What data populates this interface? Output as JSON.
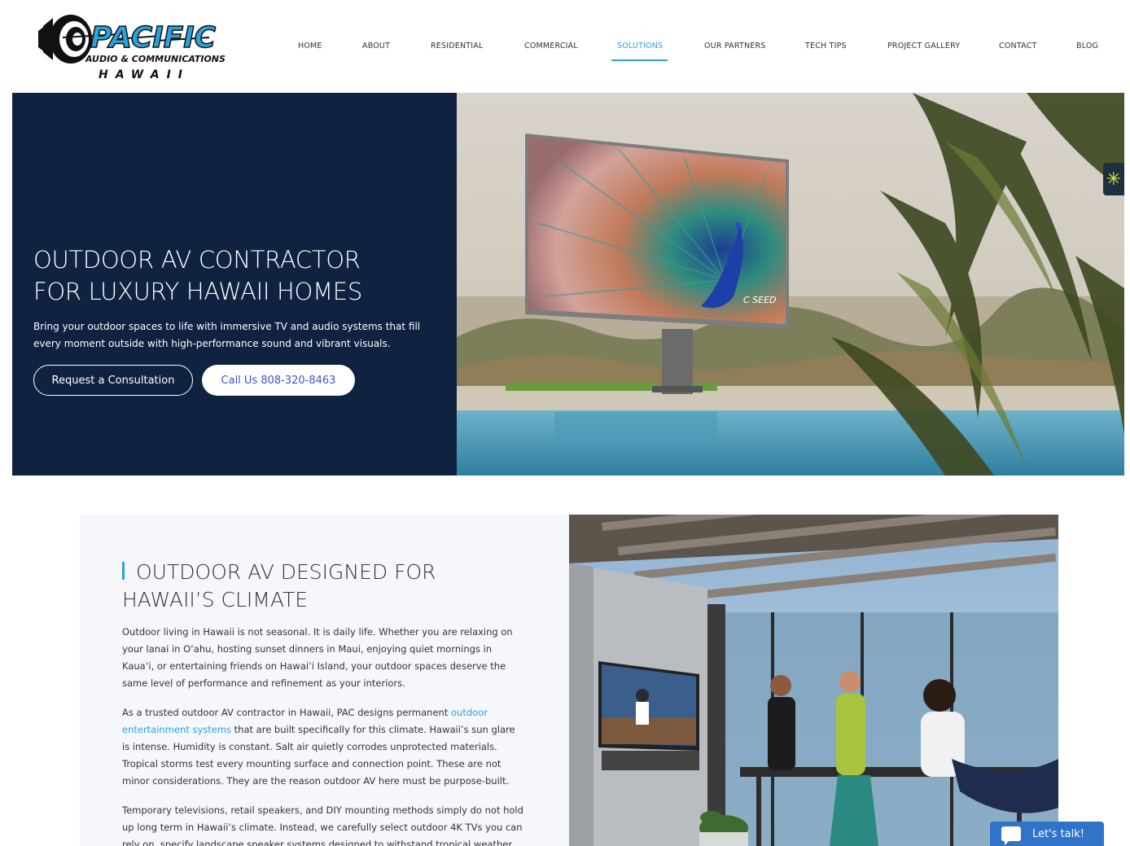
{
  "brand": {
    "logo_word": "PACIFIC",
    "logo_sub": "AUDIO & COMMUNICATIONS",
    "logo_region": "HAWAII"
  },
  "nav": {
    "items": [
      {
        "label": "HOME"
      },
      {
        "label": "ABOUT"
      },
      {
        "label": "RESIDENTIAL"
      },
      {
        "label": "COMMERCIAL"
      },
      {
        "label": "SOLUTIONS",
        "active": true
      },
      {
        "label": "OUR PARTNERS"
      },
      {
        "label": "TECH TIPS"
      },
      {
        "label": "PROJECT GALLERY"
      },
      {
        "label": "CONTACT"
      },
      {
        "label": "BLOG"
      }
    ],
    "active_color": "#29a3dd"
  },
  "hero": {
    "title_line1": "OUTDOOR AV CONTRACTOR",
    "title_line2": "FOR LUXURY HAWAII HOMES",
    "description": "Bring your outdoor spaces to life with immersive TV and audio systems that fill every moment outside with high-performance sound and vibrant visuals.",
    "consult_button": "Request a Consultation",
    "call_button": "Call Us 808-320-8463",
    "screen_brand": "C SEED",
    "bg_color": "#0f2240"
  },
  "section2": {
    "title_line1": "OUTDOOR AV DESIGNED FOR",
    "title_line2": "HAWAII’S CLIMATE",
    "para1": "Outdoor living in Hawaii is not seasonal. It is daily life. Whether you are relaxing on your lanai in O‘ahu, hosting sunset dinners in Maui, enjoying quiet mornings in Kaua‘i, or entertaining friends on Hawai‘i Island, your outdoor spaces deserve the same level of performance and refinement as your interiors.",
    "para2_before": "As a trusted outdoor AV contractor in Hawaii, PAC designs permanent ",
    "para2_link": "outdoor entertainment systems",
    "para2_after": " that are built specifically for this climate. Hawaii’s sun glare is intense. Humidity is constant. Salt air quietly corrodes unprotected materials. Tropical storms test every mounting surface and connection point. These are not minor considerations. They are the reason outdoor AV here must be purpose-built.",
    "para3": "Temporary televisions, retail speakers, and DIY mounting methods simply do not hold up long term in Hawaii’s climate. Instead, we carefully select outdoor 4K TVs you can rely on, specify landscape speaker systems designed to withstand tropical weather"
  },
  "chat": {
    "label": "Let's talk!"
  }
}
